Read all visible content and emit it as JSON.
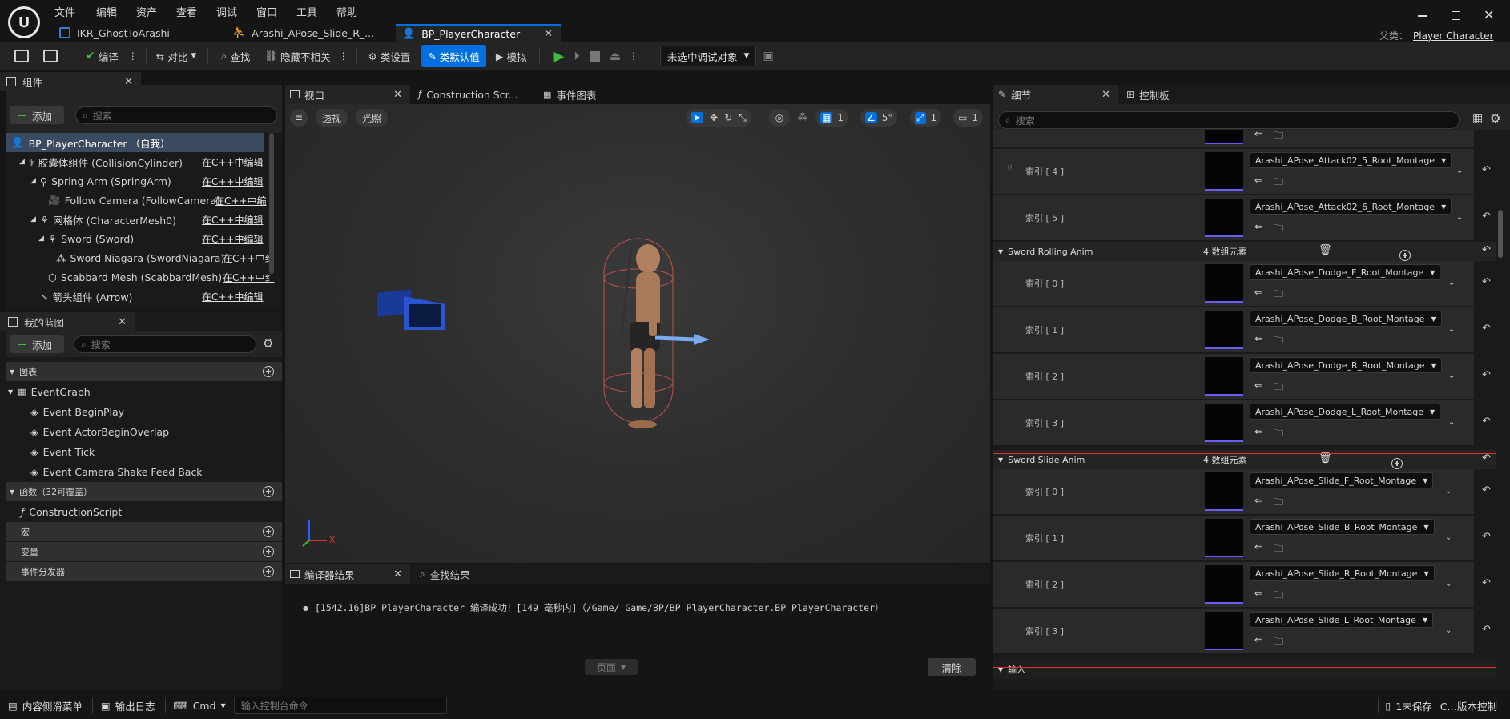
{
  "menu": [
    "文件",
    "编辑",
    "资产",
    "查看",
    "调试",
    "窗口",
    "工具",
    "帮助"
  ],
  "doc_tabs": [
    {
      "label": "IKR_GhostToArashi"
    },
    {
      "label": "Arashi_APose_Slide_R_..."
    },
    {
      "label": "BP_PlayerCharacter"
    }
  ],
  "parent_class": {
    "label": "父类：",
    "value": "Player Character"
  },
  "toolbar": {
    "compile": "编译",
    "diff": "对比",
    "find": "查找",
    "hide_unrelated": "隐藏不相关",
    "class_settings": "类设置",
    "class_defaults": "类默认值",
    "simulate": "模拟",
    "debug_target": "未选中调试对象"
  },
  "components_panel": {
    "title": "组件",
    "add": "添加",
    "search_placeholder": "搜索",
    "items": [
      {
        "label": "BP_PlayerCharacter （自我）",
        "edit": ""
      },
      {
        "label": "胶囊体组件 (CollisionCylinder)",
        "edit": "在C++中编辑"
      },
      {
        "label": "Spring Arm (SpringArm)",
        "edit": "在C++中编辑"
      },
      {
        "label": "Follow Camera (FollowCamera)",
        "edit": "在C++中编"
      },
      {
        "label": "网格体 (CharacterMesh0)",
        "edit": "在C++中编辑"
      },
      {
        "label": "Sword (Sword)",
        "edit": "在C++中编辑"
      },
      {
        "label": "Sword Niagara (SwordNiagara)",
        "edit": "在C++中纟"
      },
      {
        "label": "Scabbard Mesh (ScabbardMesh)",
        "edit": "在C++中纟"
      },
      {
        "label": "箭头组件 (Arrow)",
        "edit": "在C++中编辑"
      }
    ]
  },
  "myblueprint_panel": {
    "title": "我的蓝图",
    "add": "添加",
    "search_placeholder": "搜索",
    "graphs_header": "图表",
    "event_graph": "EventGraph",
    "events": [
      "Event BeginPlay",
      "Event ActorBeginOverlap",
      "Event Tick",
      "Event Camera Shake Feed Back"
    ],
    "functions_header": "函数（32可覆盖）",
    "construction_script": "ConstructionScript",
    "macros_header": "宏",
    "variables_header": "变量",
    "dispatchers_header": "事件分发器"
  },
  "center_tabs": {
    "viewport": "视口",
    "construction": "Construction Scr...",
    "event_graph": "事件图表"
  },
  "viewport": {
    "perspective": "透视",
    "lit": "光照",
    "grid_value": "1",
    "angle_value": "5°",
    "scale_value": "1",
    "cam_value": "1",
    "axis_x": "X"
  },
  "compiler": {
    "tab": "编译器结果",
    "find_tab": "查找结果",
    "message": "[1542.16]BP_PlayerCharacter 编译成功！[149 毫秒内]（/Game/_Game/BP/BP_PlayerCharacter.BP_PlayerCharacter）",
    "page": "页面",
    "clear": "清除"
  },
  "details": {
    "tab": "细节",
    "control_tab": "控制板",
    "search_placeholder": "搜索",
    "top_rows": [
      {
        "index": "索引 [ 4 ]",
        "asset": "Arashi_APose_Attack02_5_Root_Montage"
      },
      {
        "index": "索引 [ 5 ]",
        "asset": "Arashi_APose_Attack02_6_Root_Montage"
      }
    ],
    "rolling": {
      "name": "Sword Rolling Anim",
      "count": "4 数组元素",
      "rows": [
        {
          "index": "索引 [ 0 ]",
          "asset": "Arashi_APose_Dodge_F_Root_Montage"
        },
        {
          "index": "索引 [ 1 ]",
          "asset": "Arashi_APose_Dodge_B_Root_Montage"
        },
        {
          "index": "索引 [ 2 ]",
          "asset": "Arashi_APose_Dodge_R_Root_Montage"
        },
        {
          "index": "索引 [ 3 ]",
          "asset": "Arashi_APose_Dodge_L_Root_Montage"
        }
      ]
    },
    "slide": {
      "name": "Sword Slide Anim",
      "count": "4 数组元素",
      "rows": [
        {
          "index": "索引 [ 0 ]",
          "asset": "Arashi_APose_Slide_F_Root_Montage"
        },
        {
          "index": "索引 [ 1 ]",
          "asset": "Arashi_APose_Slide_B_Root_Montage"
        },
        {
          "index": "索引 [ 2 ]",
          "asset": "Arashi_APose_Slide_R_Root_Montage"
        },
        {
          "index": "索引 [ 3 ]",
          "asset": "Arashi_APose_Slide_L_Root_Montage"
        }
      ]
    },
    "input_header": "输入"
  },
  "statusbar": {
    "content_drawer": "内容侧滑菜单",
    "output_log": "输出日志",
    "cmd": "Cmd",
    "console_placeholder": "输入控制台命令",
    "unsaved": "1未保存",
    "source_control": "C…版本控制"
  },
  "colors": {
    "accent": "#0070e0",
    "play_green": "#3fbf3f",
    "highlight_red": "#e03030"
  }
}
